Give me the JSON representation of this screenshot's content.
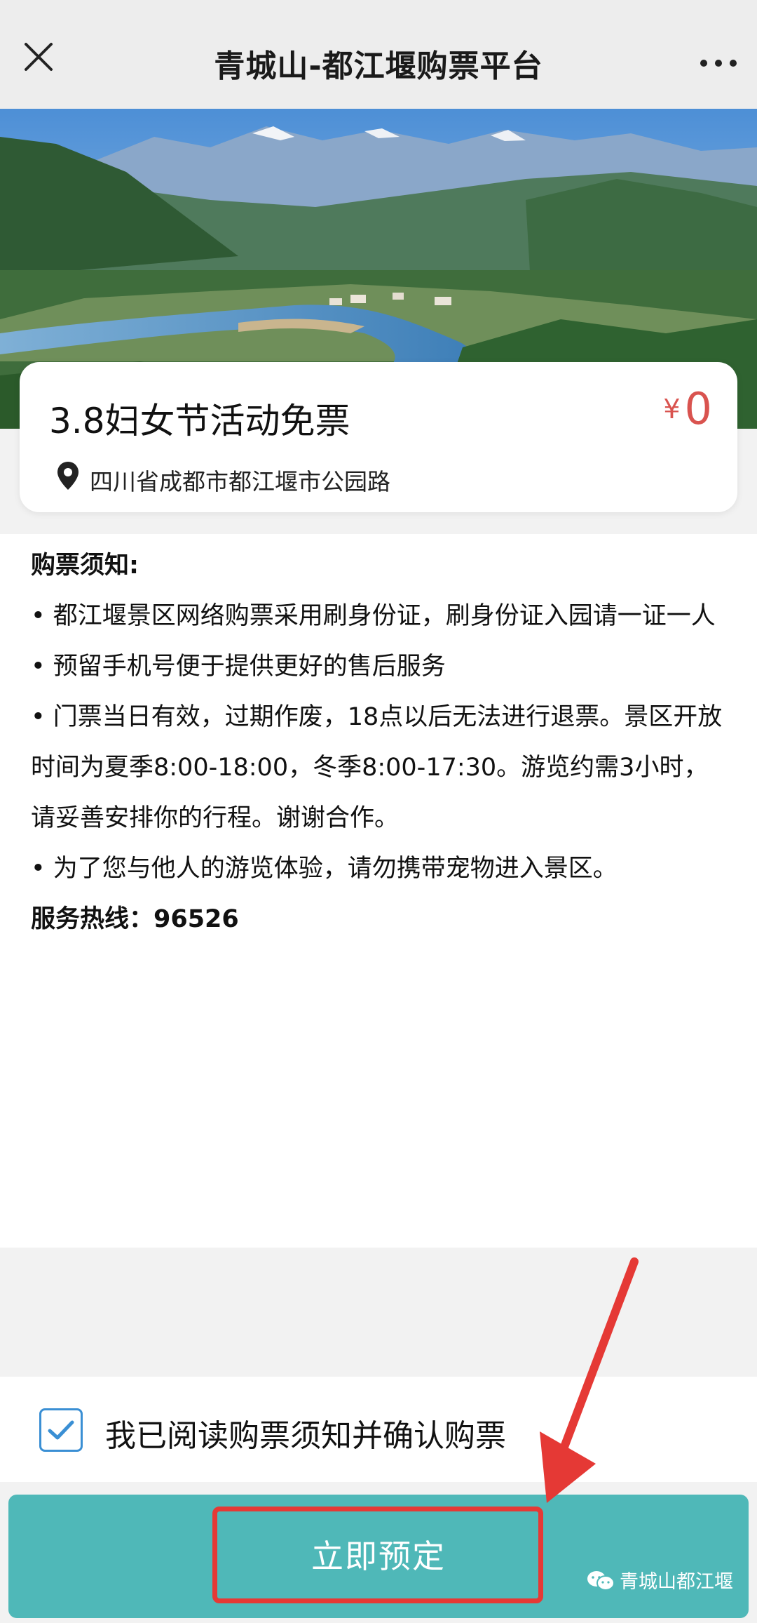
{
  "nav": {
    "title": "青城山-都江堰购票平台",
    "close_icon": "close-icon",
    "more_icon": "more-icon"
  },
  "banner": {
    "image": "mountain-river-landscape"
  },
  "ticket": {
    "title": "3.8妇女节活动免票",
    "price_symbol": "¥",
    "price": "0",
    "address": "四川省成都市都江堰市公园路",
    "location_icon": "location-pin-icon"
  },
  "notice": {
    "heading": "购票须知:",
    "items": [
      "• 都江堰景区网络购票采用刷身份证，刷身份证入园请一证一人",
      "• 预留手机号便于提供更好的售后服务",
      "• 门票当日有效，过期作废，18点以后无法进行退票。景区开放时间为夏季8:00-18:00，冬季8:00-17:30。游览约需3小时，请妥善安排你的行程。谢谢合作。",
      "• 为了您与他人的游览体验，请勿携带宠物进入景区。"
    ],
    "hotline": "服务热线：96526"
  },
  "confirm": {
    "checked": true,
    "label": "我已阅读购票须知并确认购票"
  },
  "action": {
    "book_label": "立即预定",
    "watermark": "青城山都江堰"
  },
  "colors": {
    "nav_bg": "#ededed",
    "price": "#d9534f",
    "checkbox": "#3a8fd4",
    "button": "#4fb8b8",
    "annotation": "#e53935"
  }
}
